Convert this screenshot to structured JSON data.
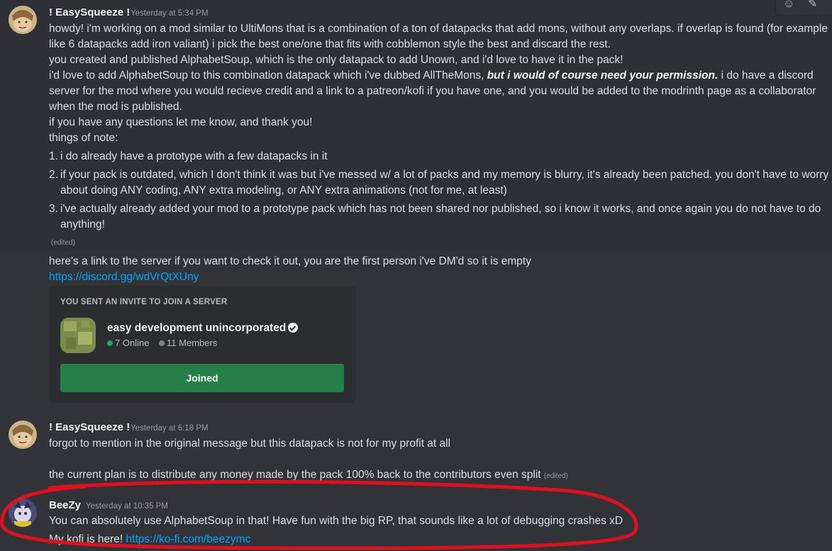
{
  "hover_toolbar": {
    "reaction_icon": "☺",
    "edit_icon": "✎"
  },
  "messages": [
    {
      "author": "! EasySqueeze !",
      "timestamp": "Yesterday at 5:34 PM",
      "lines": [
        "howdy! i'm working on a mod similar to UltiMons that is a combination of a ton of datapacks that add mons, without any overlaps. if overlap is found (for example",
        "like 6 datapacks add iron valiant) i pick the best one/one that fits with cobblemon style the best and discard the rest.",
        "you created and published AlphabetSoup, which is the only datapack to add Unown, and i'd love to have it in the pack!"
      ],
      "perm_line": {
        "before": " i'd love to add AlphabetSoup to this combination datapack which i've dubbed AllTheMons, ",
        "emphasis": "but i would of course need your permission.",
        "after": " i do have a discord"
      },
      "lines2": [
        "server for the mod where you would recieve credit and a link to a patreon/kofi if you have one, and you would be added to the modrinth page as a collaborator",
        "when the mod is published.",
        "if you have any questions let me know, and thank you!",
        "things of note:"
      ],
      "list": [
        {
          "num": "1.",
          "lines": [
            "i do already have a prototype with a few datapacks in it"
          ]
        },
        {
          "num": "2.",
          "lines": [
            "if your pack is outdated, which I don't think it was but i've messed w/ a lot of packs and my memory is blurry, it's already been patched. you don't have to worry",
            "about doing ANY coding, ANY extra modeling, or ANY extra animations (not for me, at least)"
          ]
        },
        {
          "num": "3.",
          "lines": [
            "i've actually already added your mod to a prototype pack which has not been shared nor published, so i know it works, and once again you do not have to do",
            "anything!"
          ]
        }
      ],
      "edited": "(edited)"
    },
    {
      "lines": [
        "here's a link to the server if you want to check it out, you are the first person i've DM'd so it is empty"
      ],
      "link": "https://discord.gg/wdVrQtXUny",
      "invite": {
        "header": "YOU SENT AN INVITE TO JOIN A SERVER",
        "server_name": "easy development unincorporated",
        "online": "7 Online",
        "members": "11 Members",
        "button": "Joined",
        "online_color": "#23a55a",
        "members_color": "#80848e"
      }
    },
    {
      "author": "! EasySqueeze !",
      "timestamp": "Yesterday at 6:18 PM",
      "lines": [
        "forgot to mention in the original message but this datapack is not for my profit at all"
      ],
      "line_last": "the current plan is to distribute any money made by the pack 100% back to the contributors even split ",
      "edited": "(edited)"
    },
    {
      "author": "BeeZy",
      "timestamp": "Yesterday at 10:35 PM",
      "lines": [
        "You can absolutely use AlphabetSoup in that! Have fun with the big RP, that sounds like a lot of debugging crashes xD"
      ],
      "kofi_prefix": "My kofi is here! ",
      "kofi_link": "https://ko-fi.com/beezymc"
    }
  ],
  "annotation": {
    "color": "#e0101e",
    "shape": "hand-drawn ellipse around BeeZy reply"
  }
}
